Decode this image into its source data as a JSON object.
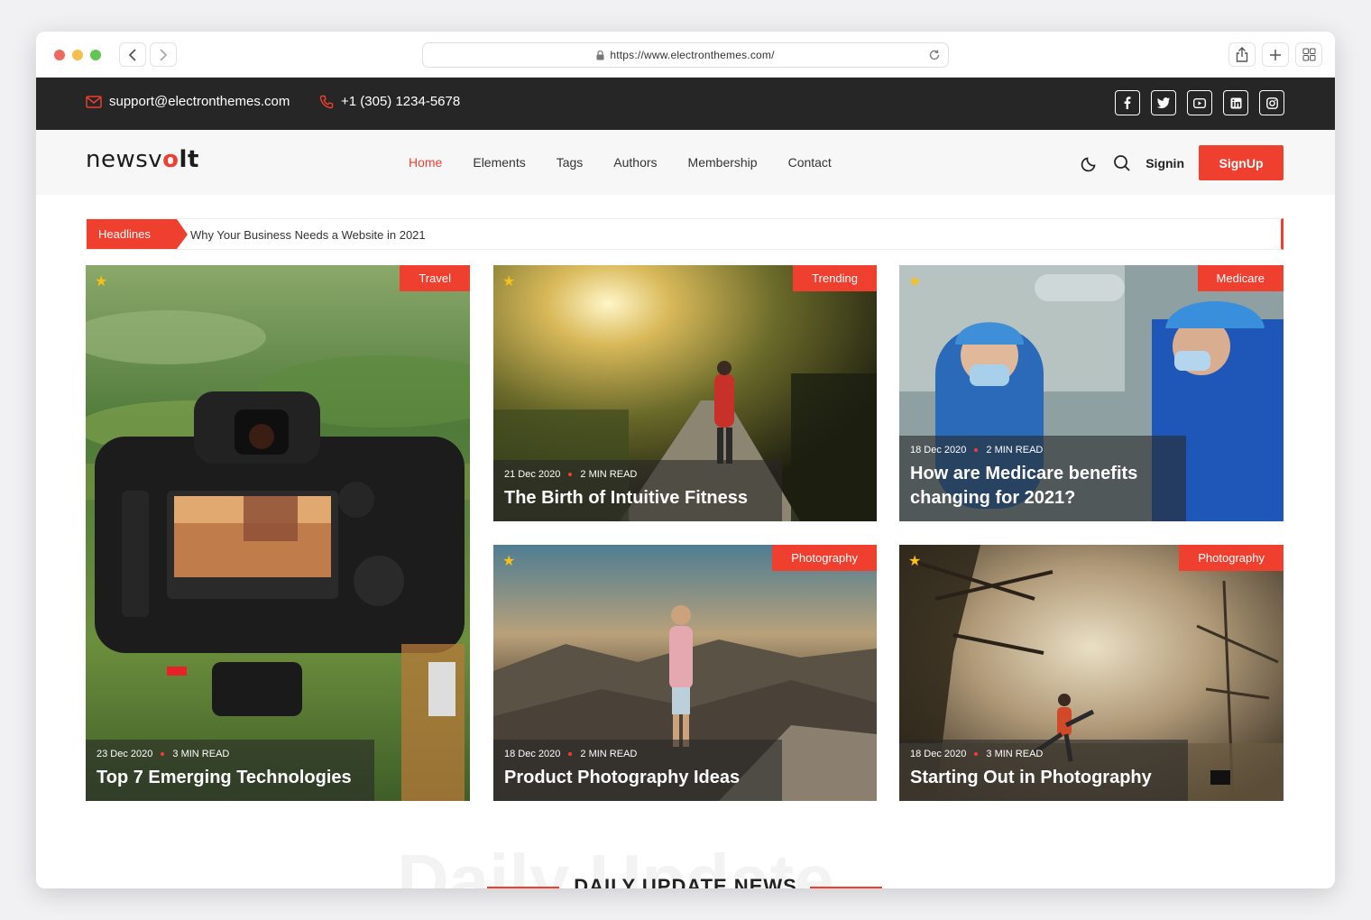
{
  "browser": {
    "url": "https://www.electronthemes.com/"
  },
  "topbar": {
    "email": "support@electronthemes.com",
    "phone": "+1 (305) 1234-5678",
    "socials": [
      "facebook-icon",
      "twitter-icon",
      "youtube-icon",
      "linkedin-icon",
      "instagram-icon"
    ]
  },
  "header": {
    "logo_pre": "newsv",
    "logo_mid": "o",
    "logo_post": "lt",
    "menu": [
      "Home",
      "Elements",
      "Tags",
      "Authors",
      "Membership",
      "Contact"
    ],
    "signin": "Signin",
    "signup": "SignUp"
  },
  "ticker": {
    "label": "Headlines",
    "text": "Why Your Business Needs a Website in 2021"
  },
  "cards": [
    {
      "category": "Travel",
      "date": "23 Dec 2020",
      "read": "3 MIN READ",
      "title": "Top 7 Emerging Technologies"
    },
    {
      "category": "Trending",
      "date": "21 Dec 2020",
      "read": "2 MIN READ",
      "title": "The Birth of Intuitive Fitness"
    },
    {
      "category": "Medicare",
      "date": "18 Dec 2020",
      "read": "2 MIN READ",
      "title": "How are Medicare benefits changing for 2021?"
    },
    {
      "category": "Photography",
      "date": "18 Dec 2020",
      "read": "2 MIN READ",
      "title": "Product Photography Ideas"
    },
    {
      "category": "Photography",
      "date": "18 Dec 2020",
      "read": "3 MIN READ",
      "title": "Starting Out in Photography"
    }
  ],
  "daily": {
    "bg_text": "Daily Update",
    "title": "DAILY UPDATE NEWS"
  },
  "colors": {
    "accent": "#ef3f2f",
    "dark_bar": "#262626",
    "star": "#f7c117"
  }
}
